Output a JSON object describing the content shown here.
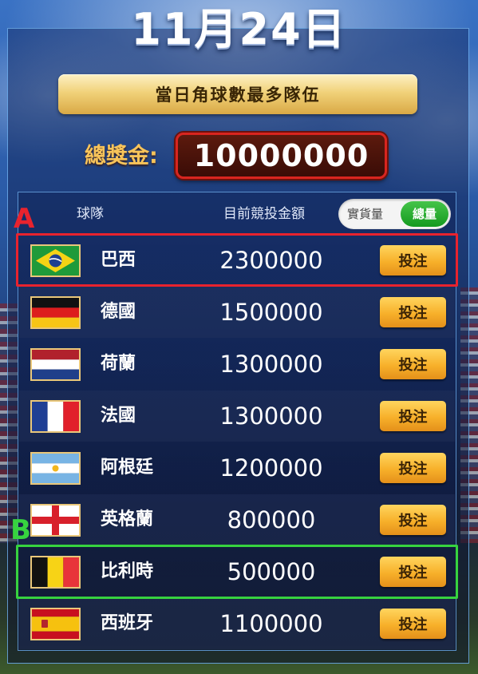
{
  "page": {
    "title": "11月24日",
    "subtitle": "當日角球數最多隊伍",
    "prize_label": "總獎金:",
    "prize_value": "10000000"
  },
  "table": {
    "headers": {
      "team": "球隊",
      "amount": "目前競投金額"
    },
    "toggle": {
      "option_off": "實貨量",
      "option_on": "總量"
    },
    "bet_label": "投注",
    "rows": [
      {
        "team": "巴西",
        "amount": "2300000",
        "flag": "brazil-flag-icon"
      },
      {
        "team": "德國",
        "amount": "1500000",
        "flag": "germany-flag-icon"
      },
      {
        "team": "荷蘭",
        "amount": "1300000",
        "flag": "netherlands-flag-icon"
      },
      {
        "team": "法國",
        "amount": "1300000",
        "flag": "france-flag-icon"
      },
      {
        "team": "阿根廷",
        "amount": "1200000",
        "flag": "argentina-flag-icon"
      },
      {
        "team": "英格蘭",
        "amount": "800000",
        "flag": "england-flag-icon"
      },
      {
        "team": "比利時",
        "amount": "500000",
        "flag": "belgium-flag-icon"
      },
      {
        "team": "西班牙",
        "amount": "1100000",
        "flag": "spain-flag-icon"
      }
    ]
  },
  "annotations": {
    "a": {
      "label": "A",
      "color": "#e8232e"
    },
    "b": {
      "label": "B",
      "color": "#37d33f"
    }
  },
  "colors": {
    "accent_gold": "#f7b02a",
    "prize_border": "#d8251f",
    "toggle_active": "#159a1f"
  }
}
